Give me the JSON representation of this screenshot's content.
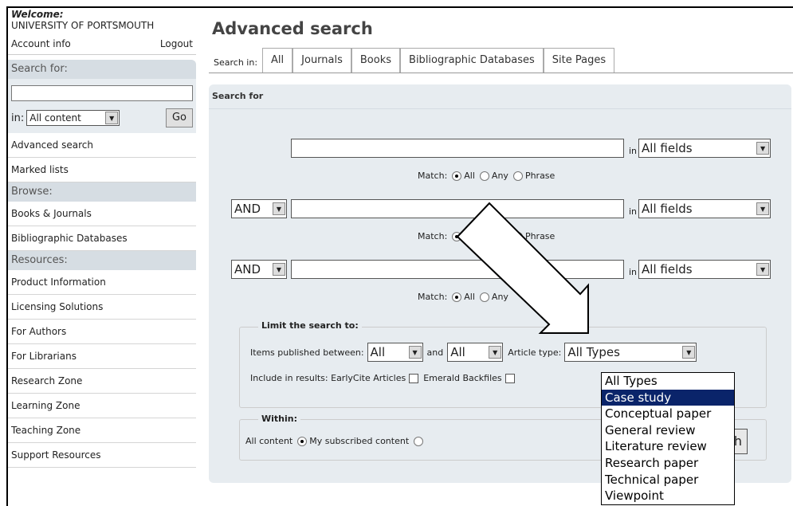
{
  "sidebar": {
    "welcome_label": "Welcome:",
    "institution": "UNIVERSITY OF PORTSMOUTH",
    "account_info": "Account info",
    "logout": "Logout",
    "search_for_heading": "Search for:",
    "in_label": "in:",
    "in_select_value": "All content",
    "go_label": "Go",
    "search_links": [
      "Advanced search",
      "Marked lists"
    ],
    "browse_heading": "Browse:",
    "browse_links": [
      "Books & Journals",
      "Bibliographic Databases"
    ],
    "resources_heading": "Resources:",
    "resource_links": [
      "Product Information",
      "Licensing Solutions",
      "For Authors",
      "For Librarians",
      "Research Zone",
      "Learning Zone",
      "Teaching Zone",
      "Support Resources"
    ]
  },
  "main": {
    "title": "Advanced search",
    "tabs_label": "Search in:",
    "tabs": [
      "All",
      "Journals",
      "Books",
      "Bibliographic Databases",
      "Site Pages"
    ],
    "panel_heading": "Search for",
    "in_word": "in",
    "field_select": "All fields",
    "operator": "AND",
    "match_label": "Match:",
    "match_all": "All",
    "match_any": "Any",
    "match_phrase": "Phrase",
    "limit_heading": "Limit the search to:",
    "items_published": "Items published between:",
    "from_value": "All",
    "and_word": "and",
    "to_value": "All",
    "article_type_label": "Article type:",
    "article_type_value": "All Types",
    "include_label": "Include in results: EarlyCite Articles",
    "emerald_backfiles": "Emerald Backfiles",
    "within_heading": "Within:",
    "within_all": "All content",
    "within_subscribed": "My subscribed content",
    "search_button_partial": "h"
  },
  "dropdown": {
    "options": [
      "All Types",
      "Case study",
      "Conceptual paper",
      "General review",
      "Literature review",
      "Research paper",
      "Technical paper",
      "Viewpoint"
    ],
    "highlighted": "Case study"
  }
}
